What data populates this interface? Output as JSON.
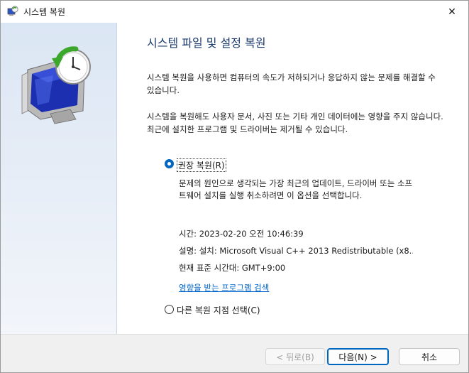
{
  "window": {
    "title": "시스템 복원"
  },
  "icons": {
    "title": "system-restore-icon",
    "close": "close-icon",
    "hero": "restore-monitor-clock-icon"
  },
  "content": {
    "heading": "시스템 파일 및 설정 복원",
    "paragraph1": "시스템 복원을 사용하면 컴퓨터의 속도가 저하되거나 응답하지 않는 문제를 해결할 수 있습니다.",
    "paragraph2": "시스템을 복원해도 사용자 문서, 사진 또는 기타 개인 데이터에는 영향을 주지 않습니다. 최근에 설치한 프로그램 및 드라이버는 제거될 수 있습니다.",
    "recommended": {
      "label": "권장 복원(R)",
      "selected": true,
      "description": "문제의 원인으로 생각되는 가장 최근의 업데이트, 드라이버 또는 소프트웨어 설치를 실행 취소하려면 이 옵션을 선택합니다.",
      "time": "시간: 2023-02-20 오전 10:46:39",
      "restore_description": "설명: 설치: Microsoft Visual C++ 2013 Redistributable (x8...",
      "timezone": "현재 표준 시간대: GMT+9:00",
      "scan_link": "영향을 받는 프로그램 검색"
    },
    "other": {
      "label": "다른 복원 지점 선택(C)",
      "selected": false
    }
  },
  "footer": {
    "back": "< 뒤로(B)",
    "next": "다음(N) >",
    "cancel": "취소"
  },
  "colors": {
    "accent": "#0067c0",
    "link": "#0066cc",
    "heading": "#1b3a6b"
  }
}
